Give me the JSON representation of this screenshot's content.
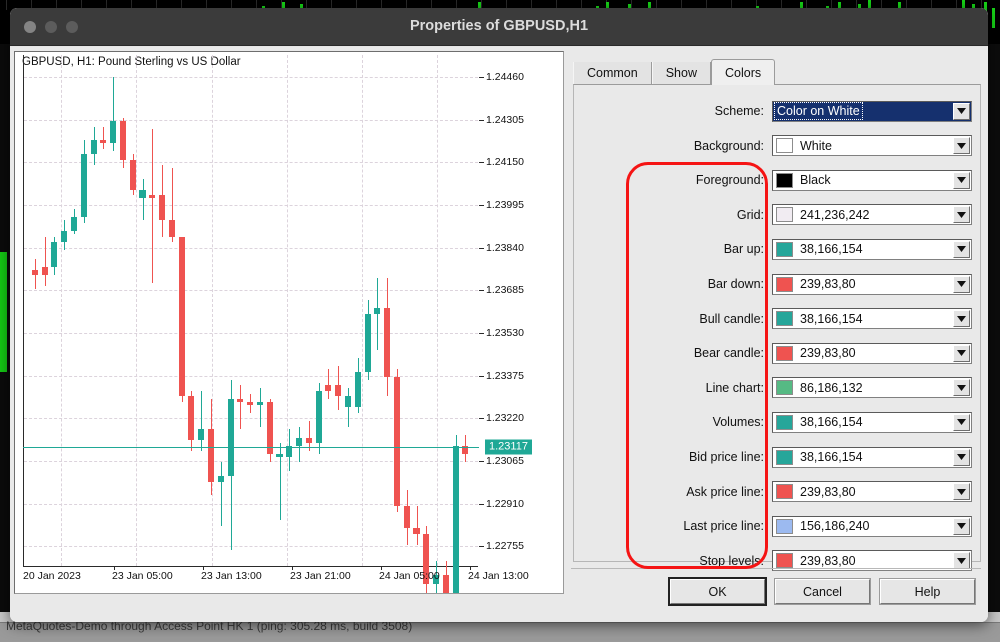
{
  "window": {
    "title": "Properties of GBPUSD,H1",
    "traffic_lights": [
      "close-button",
      "minimize-button",
      "maximize-button"
    ]
  },
  "background": {
    "status_text": "MetaQuotes-Demo through Access Point HK 1 (ping: 305.28 ms, build 3508)"
  },
  "chart_data": {
    "type": "candlestick",
    "title": "GBPUSD, H1:  Pound Sterling vs US Dollar",
    "symbol": "GBPUSD",
    "timeframe": "H1",
    "description": "Pound Sterling vs US Dollar",
    "xlabel": "",
    "ylabel": "",
    "grid": true,
    "legend": "none",
    "ylim": [
      1.2268,
      1.2454
    ],
    "y_ticks": [
      "1.24460",
      "1.24305",
      "1.24150",
      "1.23995",
      "1.23840",
      "1.23685",
      "1.23530",
      "1.23375",
      "1.23220",
      "1.23065",
      "1.22910",
      "1.22755"
    ],
    "x_ticks": [
      "20 Jan 2023",
      "23 Jan 05:00",
      "23 Jan 13:00",
      "23 Jan 21:00",
      "24 Jan 05:00",
      "24 Jan 13:00"
    ],
    "last_price": "1.23117",
    "last_price_value": 1.23117,
    "bull_color": "#1fa896",
    "bear_color": "#ef5350",
    "candles": [
      {
        "o": 1.2376,
        "h": 1.238,
        "l": 1.2369,
        "c": 1.2374,
        "dir": "down"
      },
      {
        "o": 1.2374,
        "h": 1.2388,
        "l": 1.237,
        "c": 1.2377,
        "dir": "down"
      },
      {
        "o": 1.2377,
        "h": 1.2388,
        "l": 1.2374,
        "c": 1.2386,
        "dir": "up"
      },
      {
        "o": 1.2386,
        "h": 1.2394,
        "l": 1.2383,
        "c": 1.239,
        "dir": "up"
      },
      {
        "o": 1.239,
        "h": 1.2398,
        "l": 1.2389,
        "c": 1.2395,
        "dir": "up"
      },
      {
        "o": 1.2395,
        "h": 1.2423,
        "l": 1.2393,
        "c": 1.2418,
        "dir": "up"
      },
      {
        "o": 1.2418,
        "h": 1.2428,
        "l": 1.2414,
        "c": 1.2423,
        "dir": "up"
      },
      {
        "o": 1.2423,
        "h": 1.2428,
        "l": 1.242,
        "c": 1.2422,
        "dir": "down"
      },
      {
        "o": 1.2422,
        "h": 1.2446,
        "l": 1.2419,
        "c": 1.243,
        "dir": "up"
      },
      {
        "o": 1.243,
        "h": 1.2431,
        "l": 1.2413,
        "c": 1.2416,
        "dir": "down"
      },
      {
        "o": 1.2416,
        "h": 1.2418,
        "l": 1.2403,
        "c": 1.2405,
        "dir": "down"
      },
      {
        "o": 1.2405,
        "h": 1.2409,
        "l": 1.2394,
        "c": 1.2402,
        "dir": "up"
      },
      {
        "o": 1.2402,
        "h": 1.2427,
        "l": 1.2371,
        "c": 1.2403,
        "dir": "down"
      },
      {
        "o": 1.2403,
        "h": 1.2414,
        "l": 1.2388,
        "c": 1.2394,
        "dir": "down"
      },
      {
        "o": 1.2394,
        "h": 1.2413,
        "l": 1.2386,
        "c": 1.2388,
        "dir": "down"
      },
      {
        "o": 1.2388,
        "h": 1.2388,
        "l": 1.2328,
        "c": 1.233,
        "dir": "down"
      },
      {
        "o": 1.233,
        "h": 1.2332,
        "l": 1.231,
        "c": 1.2314,
        "dir": "down"
      },
      {
        "o": 1.2314,
        "h": 1.2332,
        "l": 1.231,
        "c": 1.2318,
        "dir": "up"
      },
      {
        "o": 1.2318,
        "h": 1.2329,
        "l": 1.2294,
        "c": 1.2299,
        "dir": "down"
      },
      {
        "o": 1.2299,
        "h": 1.2306,
        "l": 1.2283,
        "c": 1.2301,
        "dir": "up"
      },
      {
        "o": 1.2301,
        "h": 1.2336,
        "l": 1.2274,
        "c": 1.2329,
        "dir": "up"
      },
      {
        "o": 1.2329,
        "h": 1.2334,
        "l": 1.2318,
        "c": 1.2328,
        "dir": "down"
      },
      {
        "o": 1.2328,
        "h": 1.2331,
        "l": 1.2324,
        "c": 1.2327,
        "dir": "down"
      },
      {
        "o": 1.2327,
        "h": 1.2333,
        "l": 1.2319,
        "c": 1.2328,
        "dir": "up"
      },
      {
        "o": 1.2328,
        "h": 1.2329,
        "l": 1.2306,
        "c": 1.2309,
        "dir": "down"
      },
      {
        "o": 1.2309,
        "h": 1.2313,
        "l": 1.2285,
        "c": 1.2308,
        "dir": "up"
      },
      {
        "o": 1.2308,
        "h": 1.2318,
        "l": 1.2303,
        "c": 1.2312,
        "dir": "up"
      },
      {
        "o": 1.2312,
        "h": 1.2319,
        "l": 1.2306,
        "c": 1.2315,
        "dir": "up"
      },
      {
        "o": 1.2315,
        "h": 1.2321,
        "l": 1.231,
        "c": 1.2313,
        "dir": "down"
      },
      {
        "o": 1.2313,
        "h": 1.2335,
        "l": 1.2309,
        "c": 1.2332,
        "dir": "up"
      },
      {
        "o": 1.2332,
        "h": 1.234,
        "l": 1.2329,
        "c": 1.2334,
        "dir": "down"
      },
      {
        "o": 1.2334,
        "h": 1.2341,
        "l": 1.2325,
        "c": 1.233,
        "dir": "down"
      },
      {
        "o": 1.233,
        "h": 1.2333,
        "l": 1.2319,
        "c": 1.2326,
        "dir": "up"
      },
      {
        "o": 1.2326,
        "h": 1.2344,
        "l": 1.2324,
        "c": 1.2339,
        "dir": "up"
      },
      {
        "o": 1.2339,
        "h": 1.2365,
        "l": 1.2336,
        "c": 1.236,
        "dir": "up"
      },
      {
        "o": 1.236,
        "h": 1.2373,
        "l": 1.2347,
        "c": 1.2362,
        "dir": "up"
      },
      {
        "o": 1.2362,
        "h": 1.2373,
        "l": 1.233,
        "c": 1.2337,
        "dir": "down"
      },
      {
        "o": 1.2337,
        "h": 1.234,
        "l": 1.2288,
        "c": 1.229,
        "dir": "down"
      },
      {
        "o": 1.229,
        "h": 1.2296,
        "l": 1.2276,
        "c": 1.2282,
        "dir": "down"
      },
      {
        "o": 1.2282,
        "h": 1.229,
        "l": 1.2276,
        "c": 1.228,
        "dir": "down"
      },
      {
        "o": 1.228,
        "h": 1.2283,
        "l": 1.2258,
        "c": 1.2262,
        "dir": "down"
      },
      {
        "o": 1.2262,
        "h": 1.227,
        "l": 1.2253,
        "c": 1.2265,
        "dir": "up"
      },
      {
        "o": 1.2265,
        "h": 1.227,
        "l": 1.2238,
        "c": 1.2241,
        "dir": "down"
      },
      {
        "o": 1.2241,
        "h": 1.2316,
        "l": 1.2239,
        "c": 1.2312,
        "dir": "up"
      },
      {
        "o": 1.2312,
        "h": 1.2316,
        "l": 1.2306,
        "c": 1.2309,
        "dir": "down"
      }
    ]
  },
  "tabs": [
    {
      "label": "Common",
      "active": false
    },
    {
      "label": "Show",
      "active": false
    },
    {
      "label": "Colors",
      "active": true
    }
  ],
  "colors_tab": {
    "rows": [
      {
        "label": "Scheme:",
        "value": "Color on White",
        "swatch": null,
        "selected": true,
        "name": "scheme"
      },
      {
        "label": "Background:",
        "value": "White",
        "swatch": "#ffffff",
        "selected": false,
        "name": "background"
      },
      {
        "label": "Foreground:",
        "value": "Black",
        "swatch": "#000000",
        "selected": false,
        "name": "foreground"
      },
      {
        "label": "Grid:",
        "value": "241,236,242",
        "swatch": "#f1ecf2",
        "selected": false,
        "name": "grid"
      },
      {
        "label": "Bar up:",
        "value": "38,166,154",
        "swatch": "#26a69a",
        "selected": false,
        "name": "bar-up"
      },
      {
        "label": "Bar down:",
        "value": "239,83,80",
        "swatch": "#ef5350",
        "selected": false,
        "name": "bar-down"
      },
      {
        "label": "Bull candle:",
        "value": "38,166,154",
        "swatch": "#26a69a",
        "selected": false,
        "name": "bull-candle"
      },
      {
        "label": "Bear candle:",
        "value": "239,83,80",
        "swatch": "#ef5350",
        "selected": false,
        "name": "bear-candle"
      },
      {
        "label": "Line chart:",
        "value": "86,186,132",
        "swatch": "#56ba84",
        "selected": false,
        "name": "line-chart"
      },
      {
        "label": "Volumes:",
        "value": "38,166,154",
        "swatch": "#26a69a",
        "selected": false,
        "name": "volumes"
      },
      {
        "label": "Bid price line:",
        "value": "38,166,154",
        "swatch": "#26a69a",
        "selected": false,
        "name": "bid-price-line"
      },
      {
        "label": "Ask price line:",
        "value": "239,83,80",
        "swatch": "#ef5350",
        "selected": false,
        "name": "ask-price-line"
      },
      {
        "label": "Last price line:",
        "value": "156,186,240",
        "swatch": "#9cbaf0",
        "selected": false,
        "name": "last-price-line"
      },
      {
        "label": "Stop levels:",
        "value": "239,83,80",
        "swatch": "#ef5350",
        "selected": false,
        "name": "stop-levels"
      }
    ],
    "highlight_color": "#f51414"
  },
  "footer": {
    "ok": "OK",
    "cancel": "Cancel",
    "help": "Help"
  }
}
